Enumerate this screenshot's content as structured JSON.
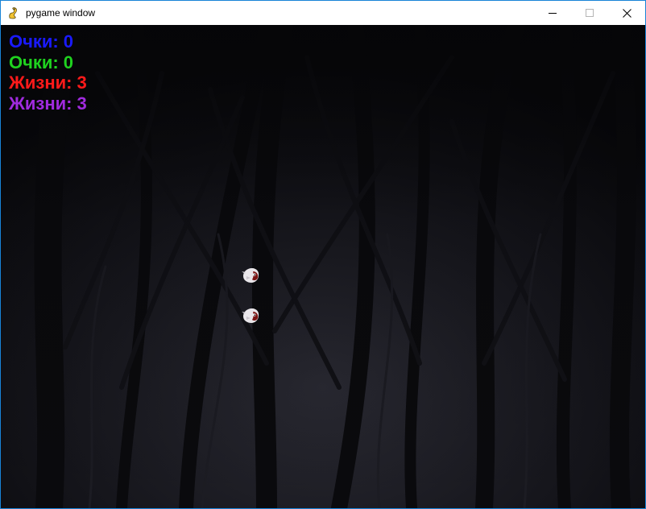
{
  "window": {
    "title": "pygame window",
    "icon": "pygame-snake-icon"
  },
  "controls": {
    "minimize_icon": "minimize-icon",
    "maximize_icon": "maximize-icon",
    "close_icon": "close-icon"
  },
  "hud": {
    "p1_score_label": "Очки:",
    "p1_score_value": "0",
    "p2_score_label": "Очки:",
    "p2_score_value": "0",
    "p1_lives_label": "Жизни:",
    "p1_lives_value": "3",
    "p2_lives_label": "Жизни:",
    "p2_lives_value": "3"
  },
  "colors": {
    "p1": "#1a1aff",
    "p2": "#1fd21f",
    "p1_lives": "#ff1a1a",
    "p2_lives": "#a02bde",
    "background": "#0b0b10"
  },
  "sprites": [
    {
      "name": "ghost-bird-1",
      "icon": "ghost-bird-icon"
    },
    {
      "name": "ghost-bird-2",
      "icon": "ghost-bird-icon"
    }
  ]
}
